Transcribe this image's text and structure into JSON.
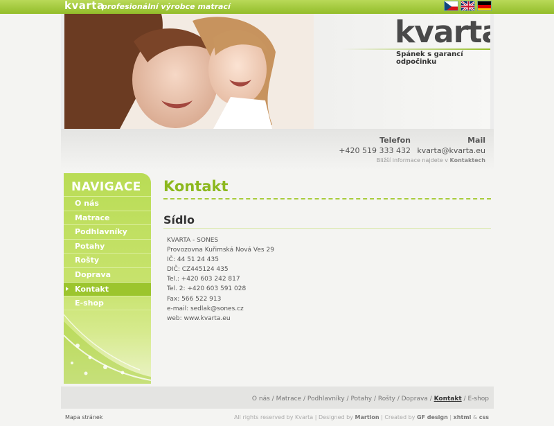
{
  "topbar": {
    "logo": "kvarta",
    "tagline": "profesionální výrobce matrací",
    "flags": [
      {
        "name": "flag-cz-icon",
        "lang": "cs"
      },
      {
        "name": "flag-uk-icon",
        "lang": "en"
      },
      {
        "name": "flag-de-icon",
        "lang": "de"
      }
    ]
  },
  "brand": {
    "word": "kvarta",
    "slogan": "Spánek s garancí odpočinku"
  },
  "contact": {
    "phone_label": "Telefon",
    "phone": "+420 519 333 432",
    "mail_label": "Mail",
    "mail": "kvarta@kvarta.eu",
    "more_prefix": "Bližší informace najdete v",
    "more_link": "Kontaktech"
  },
  "navigation": {
    "title": "NAVIGACE",
    "items": [
      {
        "label": "O nás"
      },
      {
        "label": "Matrace"
      },
      {
        "label": "Podhlavníky"
      },
      {
        "label": "Potahy"
      },
      {
        "label": "Rošty"
      },
      {
        "label": "Doprava"
      },
      {
        "label": "Kontakt",
        "active": true
      },
      {
        "label": "E-shop"
      }
    ]
  },
  "main": {
    "title": "Kontakt",
    "section": "Sídlo",
    "lines": [
      "KVARTA - SONES",
      "Provozovna Kuřimská Nová Ves 29",
      "IČ: 44 51 24 435",
      "DIČ: CZ445124 435",
      "Tel.: +420 603 242 817",
      "Tel. 2: +420 603 591 028",
      "Fax: 566 522 913",
      "e-mail: sedlak@sones.cz",
      "web: www.kvarta.eu"
    ]
  },
  "footer": {
    "links": [
      "O nás",
      "Matrace",
      "Podhlavníky",
      "Potahy",
      "Rošty",
      "Doprava",
      "Kontakt",
      "E-shop"
    ],
    "current": "Kontakt",
    "sitemap": "Mapa stránek",
    "rights": "All rights reserved by Kvarta",
    "designed_by": "Designed by",
    "designer": "Martion",
    "created_by": "Created by",
    "creator": "GF design",
    "xhtml": "xhtml",
    "amp": "&",
    "css": "css"
  },
  "colors": {
    "accent": "#8cb81e",
    "nav_bg": "#b9dc55",
    "nav_active": "#9cc52d"
  }
}
